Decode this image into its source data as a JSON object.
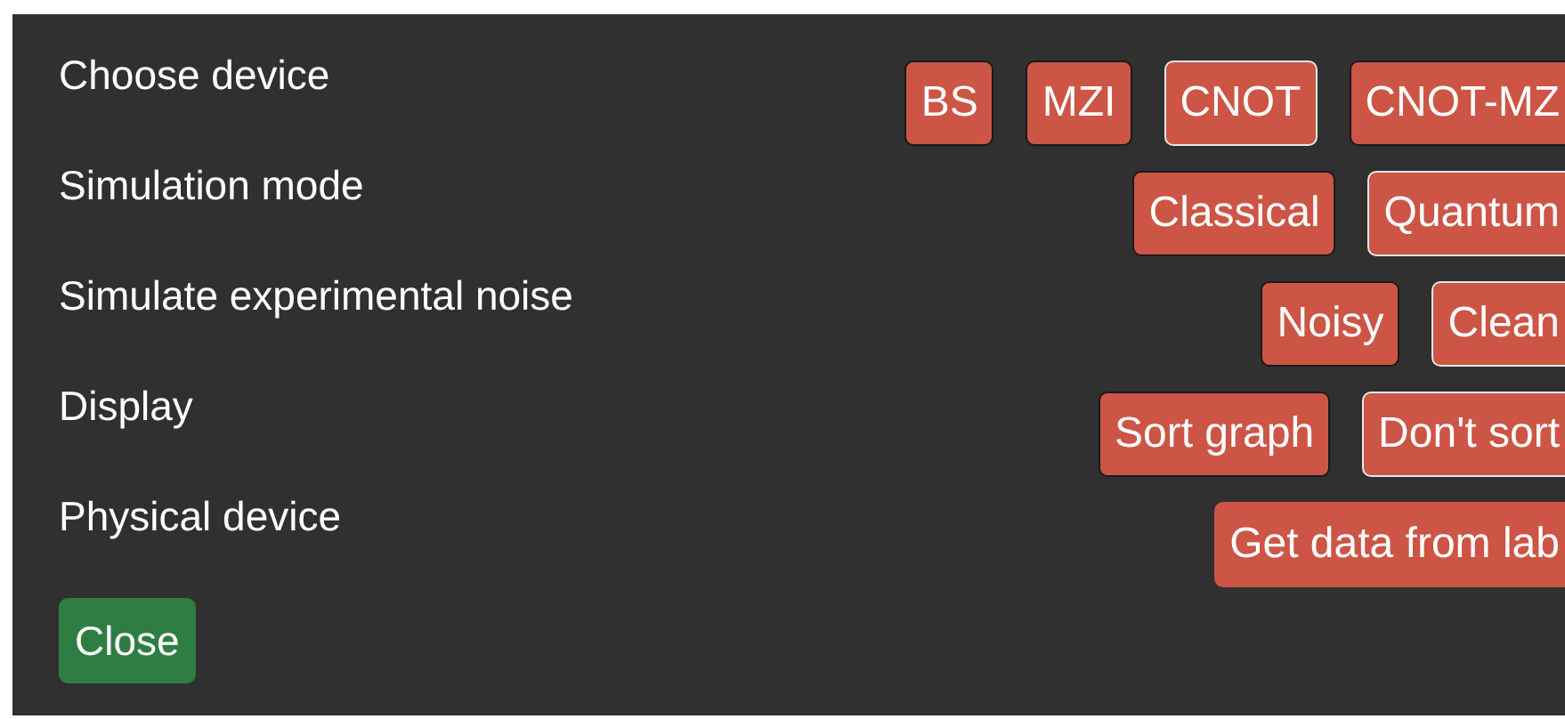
{
  "settings": [
    {
      "label": "Choose device",
      "options": [
        {
          "label": "BS",
          "selected": false
        },
        {
          "label": "MZI",
          "selected": false
        },
        {
          "label": "CNOT",
          "selected": true
        },
        {
          "label": "CNOT-MZ",
          "selected": false
        }
      ]
    },
    {
      "label": "Simulation mode",
      "options": [
        {
          "label": "Classical",
          "selected": false
        },
        {
          "label": "Quantum",
          "selected": true
        }
      ]
    },
    {
      "label": "Simulate experimental noise",
      "options": [
        {
          "label": "Noisy",
          "selected": false
        },
        {
          "label": "Clean",
          "selected": true
        }
      ]
    },
    {
      "label": "Display",
      "options": [
        {
          "label": "Sort graph",
          "selected": false
        },
        {
          "label": "Don't sort",
          "selected": true
        }
      ]
    },
    {
      "label": "Physical device",
      "options": [
        {
          "label": "Get data from lab"
        }
      ]
    }
  ],
  "close_button": "Close"
}
